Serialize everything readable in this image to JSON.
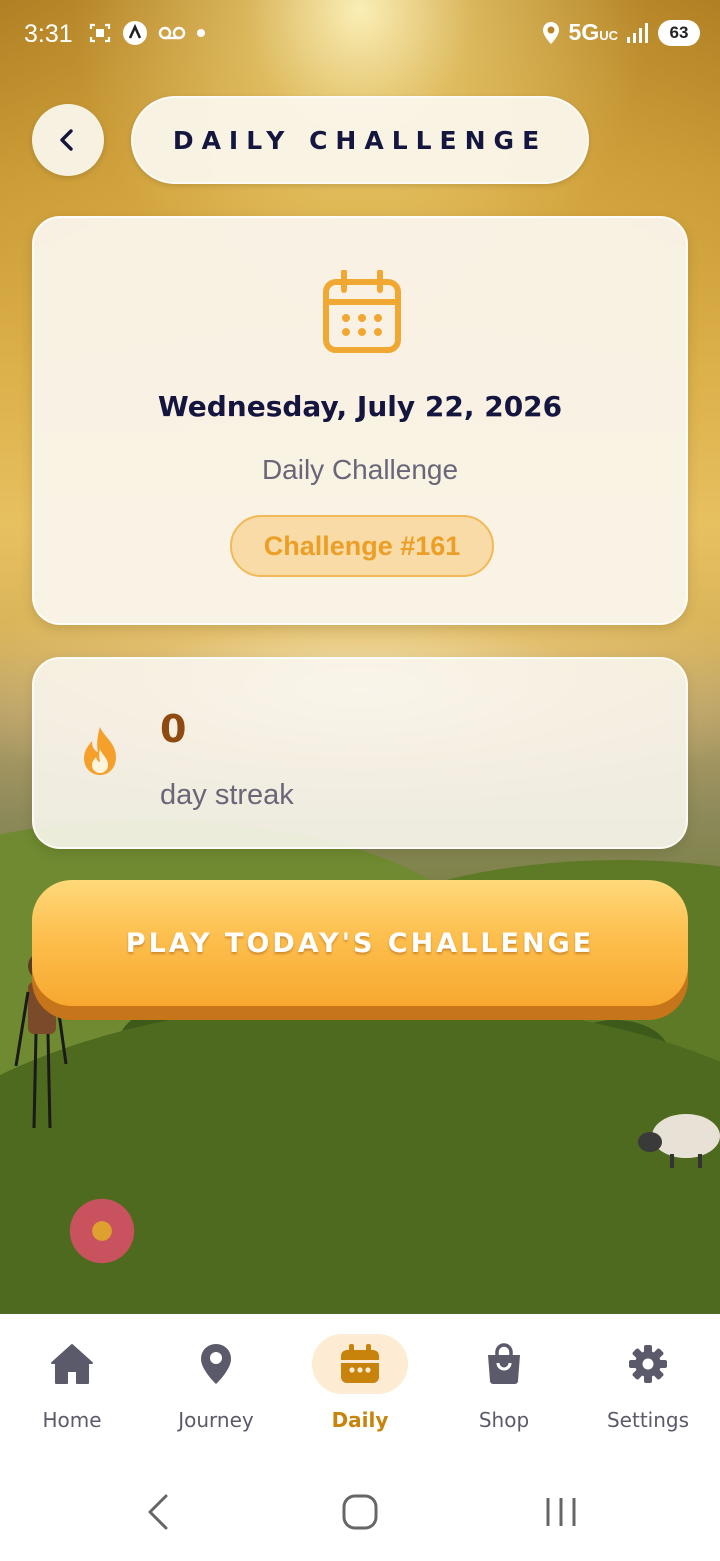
{
  "status_bar": {
    "time": "3:31",
    "network": "5G",
    "network_sub": "UC",
    "battery": "63"
  },
  "header": {
    "title": "DAILY CHALLENGE",
    "back_icon": "chevron-left-icon"
  },
  "challenge_card": {
    "date": "Wednesday, July 22, 2026",
    "subtitle": "Daily Challenge",
    "badge": "Challenge #161",
    "icon": "calendar-icon"
  },
  "streak": {
    "value": "0",
    "label": "day streak",
    "icon": "flame-icon"
  },
  "play_button": {
    "label": "PLAY TODAY'S CHALLENGE"
  },
  "bottom_nav": {
    "items": [
      {
        "label": "Home",
        "icon": "home-icon",
        "active": false
      },
      {
        "label": "Journey",
        "icon": "map-pin-icon",
        "active": false
      },
      {
        "label": "Daily",
        "icon": "calendar-icon",
        "active": true
      },
      {
        "label": "Shop",
        "icon": "shopping-bag-icon",
        "active": false
      },
      {
        "label": "Settings",
        "icon": "gear-icon",
        "active": false
      }
    ]
  },
  "colors": {
    "accent": "#F8A82F",
    "active_nav": "#C7830C",
    "title_text": "#15163F",
    "badge_text": "#EB9F27",
    "streak_value": "#8F4A12"
  }
}
